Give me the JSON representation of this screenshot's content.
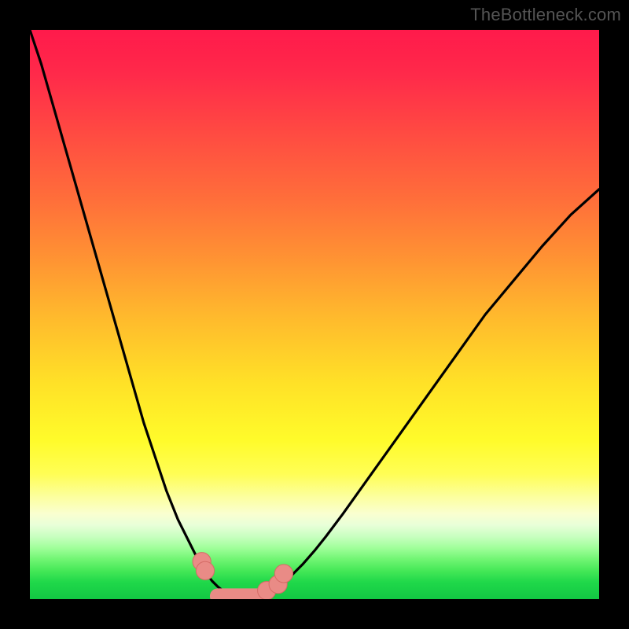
{
  "watermark": {
    "text": "TheBottleneck.com"
  },
  "colors": {
    "background": "#000000",
    "curve_stroke": "#000000",
    "marker_fill": "#e98b86",
    "marker_stroke": "#d56b66"
  },
  "chart_data": {
    "type": "line",
    "title": "",
    "xlabel": "",
    "ylabel": "",
    "xlim": [
      0,
      100
    ],
    "ylim": [
      0,
      100
    ],
    "grid": false,
    "axes_visible": false,
    "series": [
      {
        "name": "bottleneck-curve",
        "x": [
          0,
          2,
          4,
          6,
          8,
          10,
          12,
          14,
          16,
          18,
          20,
          22,
          24,
          26,
          28,
          30,
          31,
          32,
          33,
          34,
          35,
          36,
          37,
          38,
          40,
          42,
          44,
          46,
          48,
          50,
          52,
          55,
          60,
          65,
          70,
          75,
          80,
          85,
          90,
          95,
          100
        ],
        "y": [
          100,
          94,
          87,
          80,
          73,
          66,
          59,
          52,
          45,
          38,
          31,
          25,
          19,
          14,
          10,
          6,
          4.5,
          3.2,
          2.2,
          1.4,
          0.8,
          0.4,
          0.15,
          0.2,
          0.6,
          1.4,
          2.6,
          4.2,
          6.2,
          8.5,
          11,
          15,
          22,
          29,
          36,
          43,
          50,
          56,
          62,
          67.5,
          72
        ]
      }
    ],
    "markers": [
      {
        "type": "line_segment",
        "x1": 33.0,
        "y1": 0.5,
        "x2": 40.2,
        "y2": 0.5
      },
      {
        "type": "circle",
        "x": 30.2,
        "y": 6.6,
        "r": 1.6
      },
      {
        "type": "circle",
        "x": 30.8,
        "y": 5.0,
        "r": 1.6
      },
      {
        "type": "circle",
        "x": 41.6,
        "y": 1.5,
        "r": 1.6
      },
      {
        "type": "circle",
        "x": 43.6,
        "y": 2.6,
        "r": 1.6
      },
      {
        "type": "circle",
        "x": 44.6,
        "y": 4.5,
        "r": 1.6
      }
    ]
  }
}
